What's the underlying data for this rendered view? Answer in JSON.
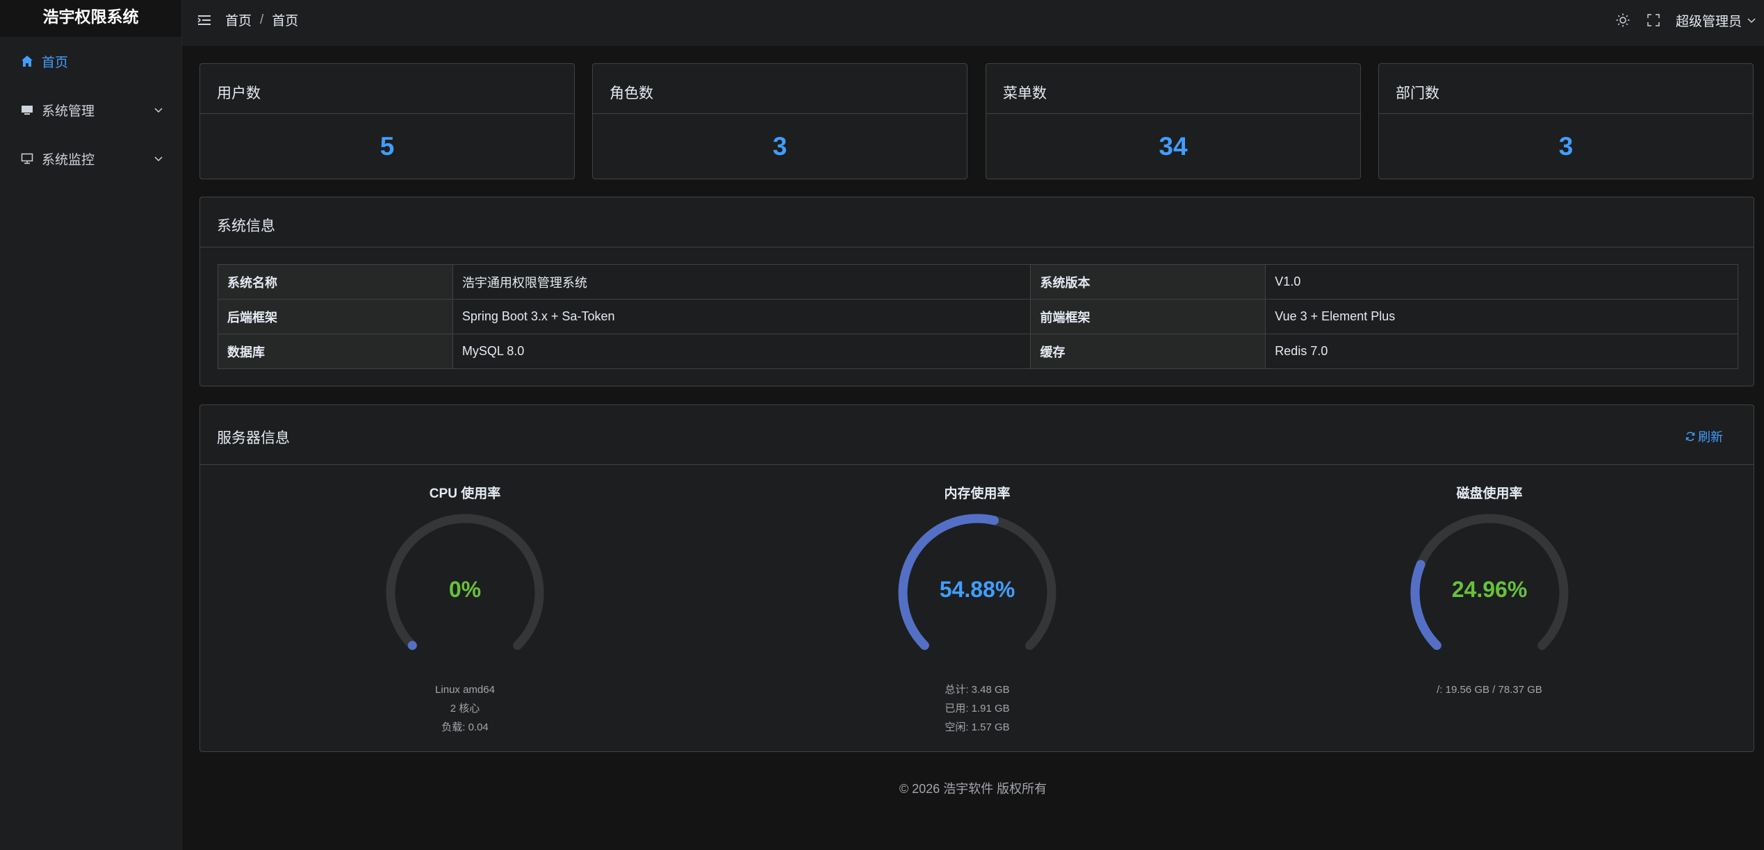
{
  "brand": "浩宇权限系统",
  "sidebar": {
    "items": [
      {
        "label": "首页",
        "icon": "home-icon"
      },
      {
        "label": "系统管理",
        "icon": "monitor-icon"
      },
      {
        "label": "系统监控",
        "icon": "desktop-icon"
      }
    ]
  },
  "header": {
    "breadcrumb": [
      "首页",
      "首页"
    ],
    "breadcrumb_sep": "/",
    "user": "超级管理员"
  },
  "stats": [
    {
      "title": "用户数",
      "value": "5"
    },
    {
      "title": "角色数",
      "value": "3"
    },
    {
      "title": "菜单数",
      "value": "34"
    },
    {
      "title": "部门数",
      "value": "3"
    }
  ],
  "system_info": {
    "title": "系统信息",
    "rows": [
      [
        "系统名称",
        "浩宇通用权限管理系统",
        "系统版本",
        "V1.0"
      ],
      [
        "后端框架",
        "Spring Boot 3.x + Sa-Token",
        "前端框架",
        "Vue 3 + Element Plus"
      ],
      [
        "数据库",
        "MySQL 8.0",
        "缓存",
        "Redis 7.0"
      ]
    ]
  },
  "server_info": {
    "title": "服务器信息",
    "refresh_label": "刷新",
    "gauges": [
      {
        "title": "CPU 使用率",
        "value_text": "0%",
        "percent": 0,
        "text_color": "#67c23a",
        "lines": [
          "Linux amd64",
          "2 核心",
          "负载: 0.04"
        ]
      },
      {
        "title": "内存使用率",
        "value_text": "54.88%",
        "percent": 54.88,
        "text_color": "#409eff",
        "lines": [
          "总计: 3.48 GB",
          "已用: 1.91 GB",
          "空闲: 1.57 GB"
        ]
      },
      {
        "title": "磁盘使用率",
        "value_text": "24.96%",
        "percent": 24.96,
        "text_color": "#67c23a",
        "lines": [
          "/: 19.56 GB / 78.37 GB"
        ]
      }
    ]
  },
  "footer": "© 2026 浩宇软件 版权所有",
  "colors": {
    "accent": "#409eff",
    "success": "#67c23a",
    "gauge_fill": "#5470c6",
    "gauge_track": "#353637"
  }
}
